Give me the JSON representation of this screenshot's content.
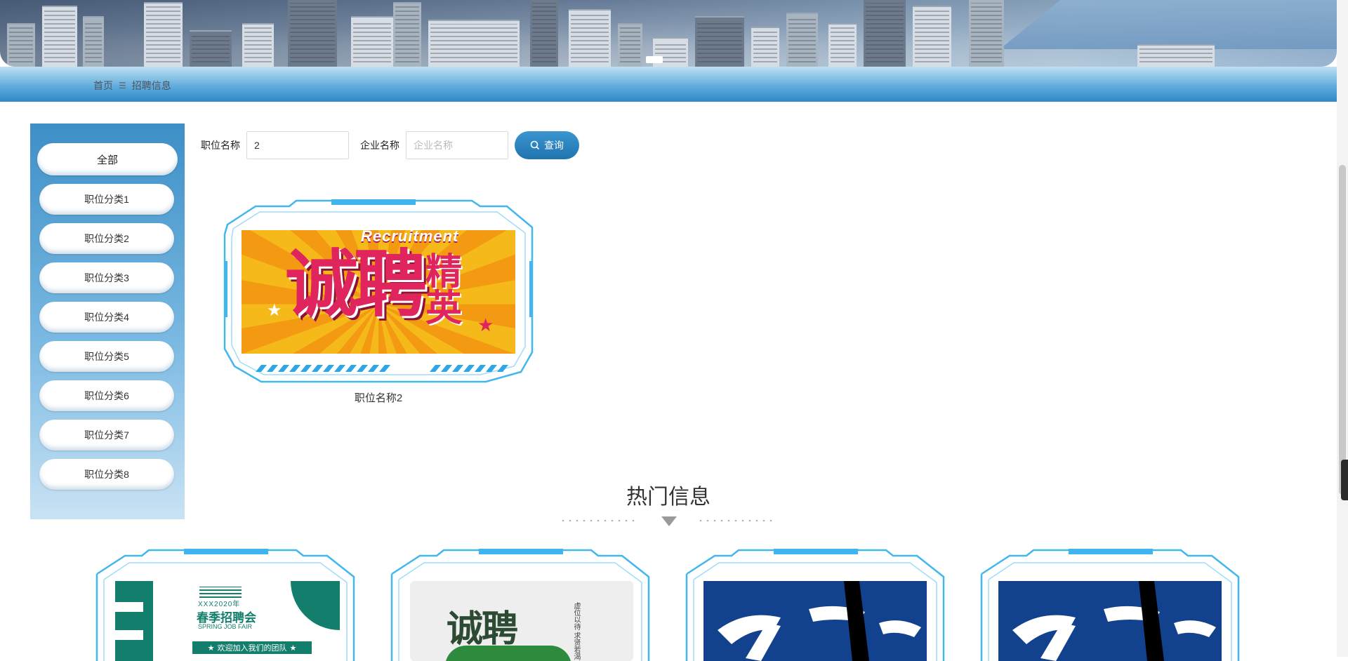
{
  "breadcrumb": {
    "home": "首页",
    "separator": "☰",
    "current": "招聘信息"
  },
  "sidebar": {
    "items": [
      {
        "label": "全部",
        "active": true
      },
      {
        "label": "职位分类1"
      },
      {
        "label": "职位分类2"
      },
      {
        "label": "职位分类3"
      },
      {
        "label": "职位分类4"
      },
      {
        "label": "职位分类5"
      },
      {
        "label": "职位分类6"
      },
      {
        "label": "职位分类7"
      },
      {
        "label": "职位分类8"
      }
    ]
  },
  "search": {
    "job_label": "职位名称",
    "job_value": "2",
    "company_label": "企业名称",
    "company_placeholder": "企业名称",
    "button_label": "查询",
    "button_icon": "search-icon"
  },
  "job_card": {
    "title": "职位名称2",
    "image": {
      "text_main": "诚聘",
      "text_side": "精英",
      "text_top": "Recruitment"
    }
  },
  "hot_section": {
    "title": "热门信息",
    "cards": [
      {
        "poster": "spring-fair",
        "year_text": "XXX2020年",
        "title_text": "春季招聘会",
        "sub_text": "SPRING JOB FAIR",
        "banner_text": "欢迎加入我们的团队"
      },
      {
        "poster": "ink-recruit",
        "main_text": "诚聘",
        "side_text": "虚位以待 求贤若渴"
      },
      {
        "poster": "blue-calligraphy"
      },
      {
        "poster": "blue-calligraphy"
      }
    ]
  },
  "colors": {
    "accent": "#2a86c4",
    "frame": "#3fb4ee",
    "sidebar_top": "#3d8fc7"
  }
}
